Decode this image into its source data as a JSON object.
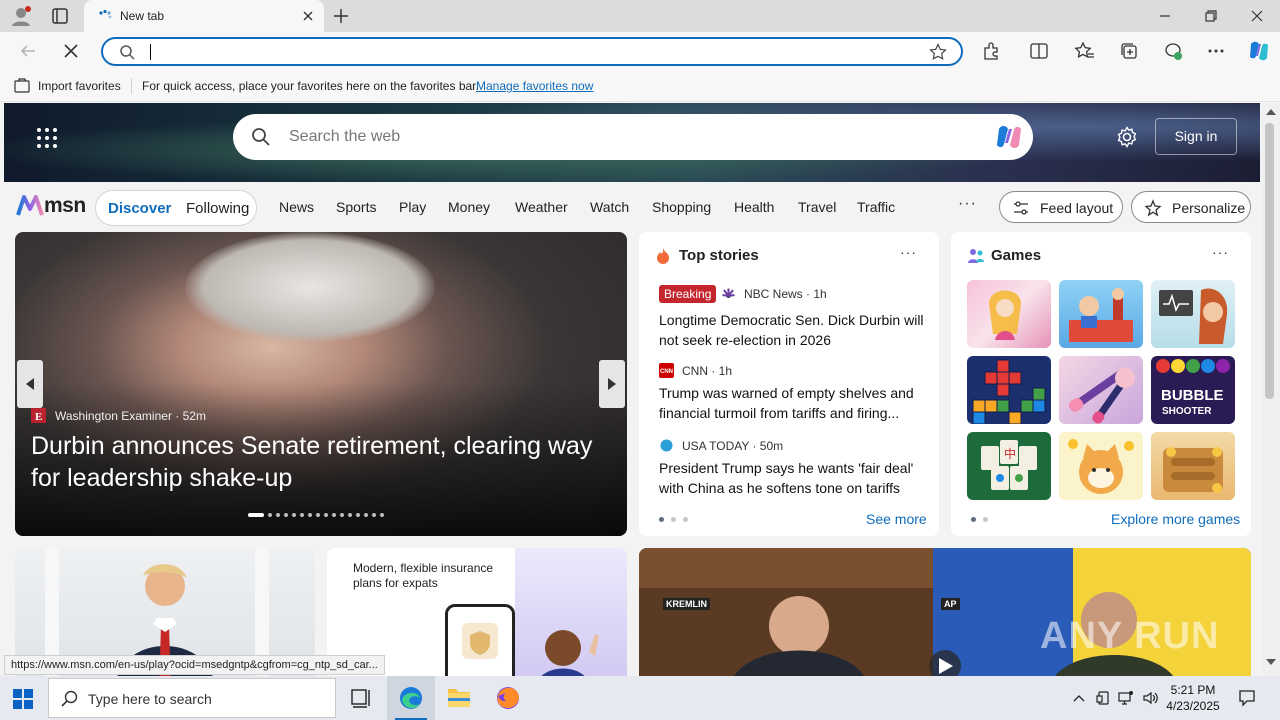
{
  "browser": {
    "tab_title": "New tab",
    "address_value": "",
    "favorites_bar": {
      "import_label": "Import favorites",
      "message": "For quick access, place your favorites here on the favorites bar.",
      "manage_link": "Manage favorites now"
    },
    "status_url": "https://www.msn.com/en-us/play?ocid=msedgntp&cgfrom=cg_ntp_sd_car..."
  },
  "msn": {
    "search_placeholder": "Search the web",
    "sign_in": "Sign in",
    "logo_text": "msn",
    "discover": "Discover",
    "following": "Following",
    "nav": [
      "News",
      "Sports",
      "Play",
      "Money",
      "Weather",
      "Watch",
      "Shopping",
      "Health",
      "Travel",
      "Traffic"
    ],
    "nav_more": "···",
    "feed_layout": "Feed layout",
    "personalize": "Personalize",
    "hero": {
      "source": "Washington Examiner",
      "age": "52m",
      "source_line": "Washington Examiner · 52m",
      "title": "Durbin announces Senate retirement, clearing way for leadership shake-up",
      "slide_count": 16,
      "active_slide": 1
    },
    "top_stories": {
      "title": "Top stories",
      "more": "···",
      "items": [
        {
          "badge": "Breaking",
          "source": "NBC News · 1h",
          "headline": "Longtime Democratic Sen. Dick Durbin will not seek re-election in 2026"
        },
        {
          "badge": "",
          "source": "CNN · 1h",
          "headline": "Trump was warned of empty shelves and financial turmoil from tariffs and firing..."
        },
        {
          "badge": "",
          "source": "USA TODAY · 50m",
          "headline": "President Trump says he wants 'fair deal' with China as he softens tone on tariffs"
        }
      ],
      "see_more": "See more"
    },
    "games": {
      "title": "Games",
      "more": "···",
      "explore": "Explore more games"
    },
    "insurance_ad": {
      "text": "Modern, flexible insurance plans for expats"
    },
    "video_labels": {
      "left": "KREMLIN",
      "right": "AP"
    },
    "watermark": "ANY RUN"
  },
  "taskbar": {
    "search_placeholder": "Type here to search",
    "time": "5:21 PM",
    "date": "4/23/2025"
  },
  "colors": {
    "accent": "#0f6cbd",
    "breaking": "#c4262e"
  }
}
